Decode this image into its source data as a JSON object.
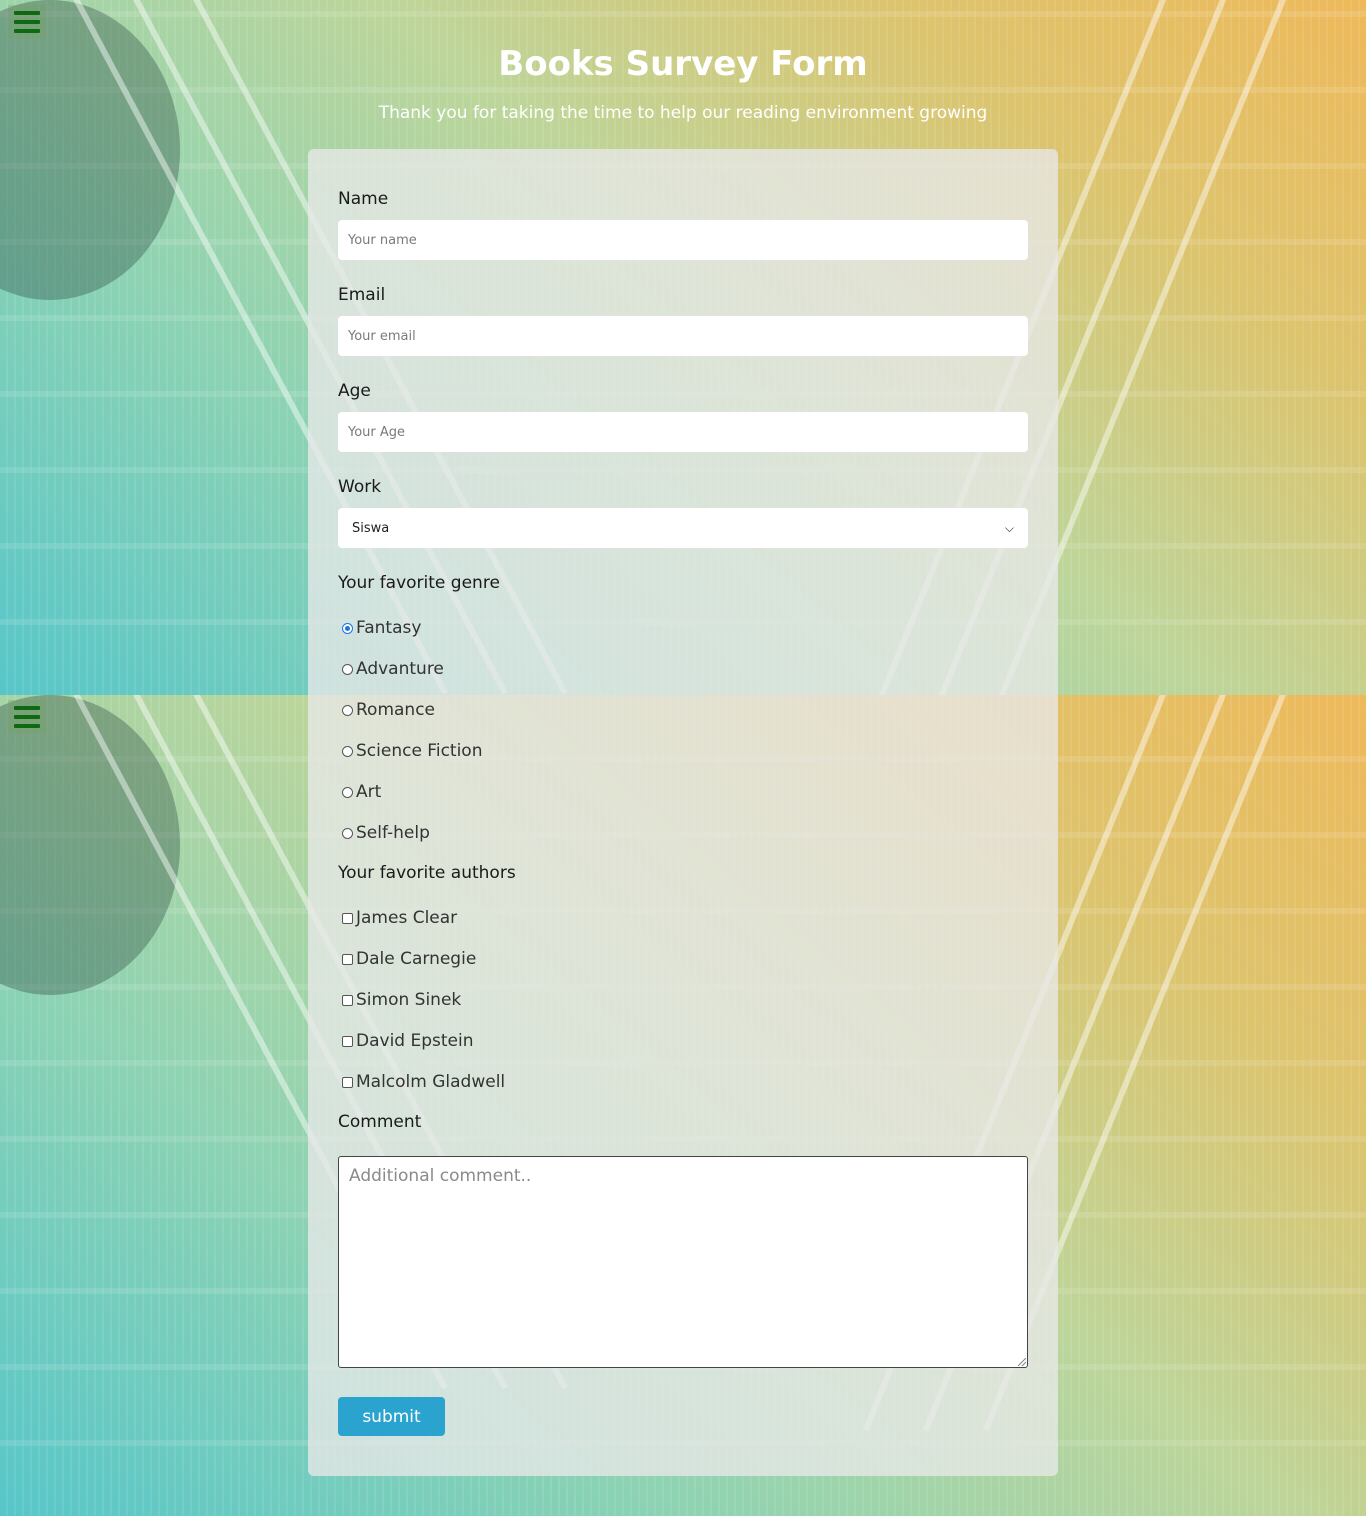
{
  "header": {
    "title": "Books Survey Form",
    "subtitle": "Thank you for taking the time to help our reading environment growing"
  },
  "menu": {
    "icon": "hamburger-menu-icon"
  },
  "form": {
    "name": {
      "label": "Name",
      "placeholder": "Your name"
    },
    "email": {
      "label": "Email",
      "placeholder": "Your email"
    },
    "age": {
      "label": "Age",
      "placeholder": "Your Age"
    },
    "work": {
      "label": "Work",
      "selected": "Siswa"
    },
    "genre": {
      "label": "Your favorite genre",
      "options": [
        "Fantasy",
        "Advanture",
        "Romance",
        "Science Fiction",
        "Art",
        "Self-help"
      ],
      "selected": "Fantasy"
    },
    "authors": {
      "label": "Your favorite authors",
      "options": [
        "James Clear",
        "Dale Carnegie",
        "Simon Sinek",
        "David Epstein",
        "Malcolm Gladwell"
      ]
    },
    "comment": {
      "label": "Comment",
      "placeholder": "Additional comment.."
    },
    "submit_label": "submit"
  }
}
